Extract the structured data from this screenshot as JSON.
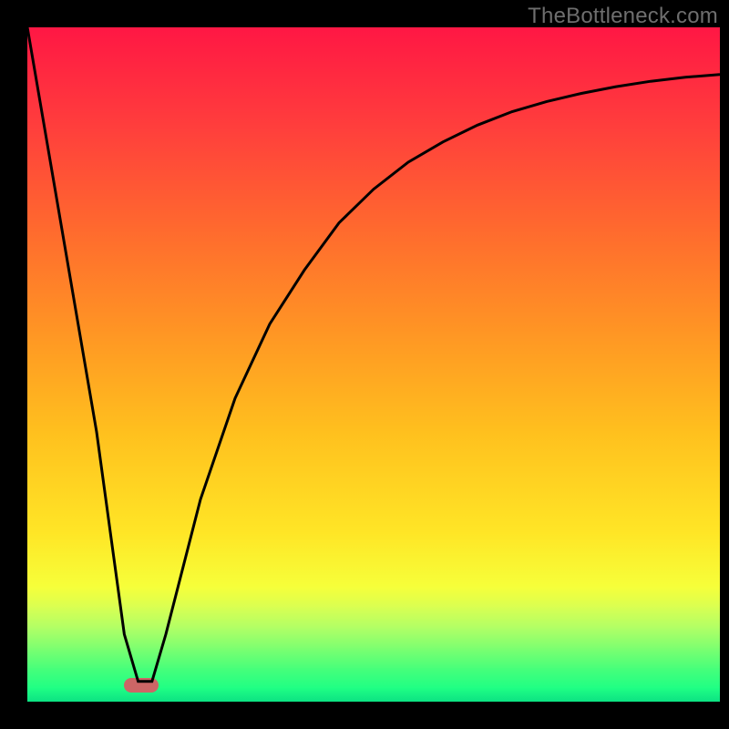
{
  "watermark": "TheBottleneck.com",
  "chart_data": {
    "type": "line",
    "title": "",
    "xlabel": "",
    "ylabel": "",
    "xlim": [
      0,
      100
    ],
    "ylim": [
      0,
      100
    ],
    "grid": false,
    "legend": false,
    "series": [
      {
        "name": "bottleneck-curve",
        "x": [
          0,
          5,
          10,
          14,
          16,
          18,
          20,
          25,
          30,
          35,
          40,
          45,
          50,
          55,
          60,
          65,
          70,
          75,
          80,
          85,
          90,
          95,
          100
        ],
        "values": [
          100,
          70,
          40,
          10,
          3,
          3,
          10,
          30,
          45,
          56,
          64,
          71,
          76,
          80,
          83,
          85.5,
          87.5,
          89,
          90.2,
          91.2,
          92,
          92.6,
          93
        ]
      }
    ],
    "bottleneck_marker": {
      "x_start": 14,
      "x_end": 19,
      "y": 2.5
    },
    "background_gradient": {
      "stops": [
        {
          "pos": 0.0,
          "color": "#ff1744"
        },
        {
          "pos": 0.15,
          "color": "#ff3f3c"
        },
        {
          "pos": 0.3,
          "color": "#ff6a2e"
        },
        {
          "pos": 0.45,
          "color": "#ff9524"
        },
        {
          "pos": 0.6,
          "color": "#ffc01e"
        },
        {
          "pos": 0.75,
          "color": "#ffe626"
        },
        {
          "pos": 0.83,
          "color": "#f6ff3a"
        },
        {
          "pos": 0.86,
          "color": "#d9ff52"
        },
        {
          "pos": 0.89,
          "color": "#b0ff66"
        },
        {
          "pos": 0.92,
          "color": "#7dff70"
        },
        {
          "pos": 0.95,
          "color": "#48ff7a"
        },
        {
          "pos": 0.98,
          "color": "#1fff84"
        },
        {
          "pos": 1.0,
          "color": "#0be083"
        }
      ]
    }
  },
  "colors": {
    "marker": "#cc6666",
    "curve": "#000000"
  }
}
